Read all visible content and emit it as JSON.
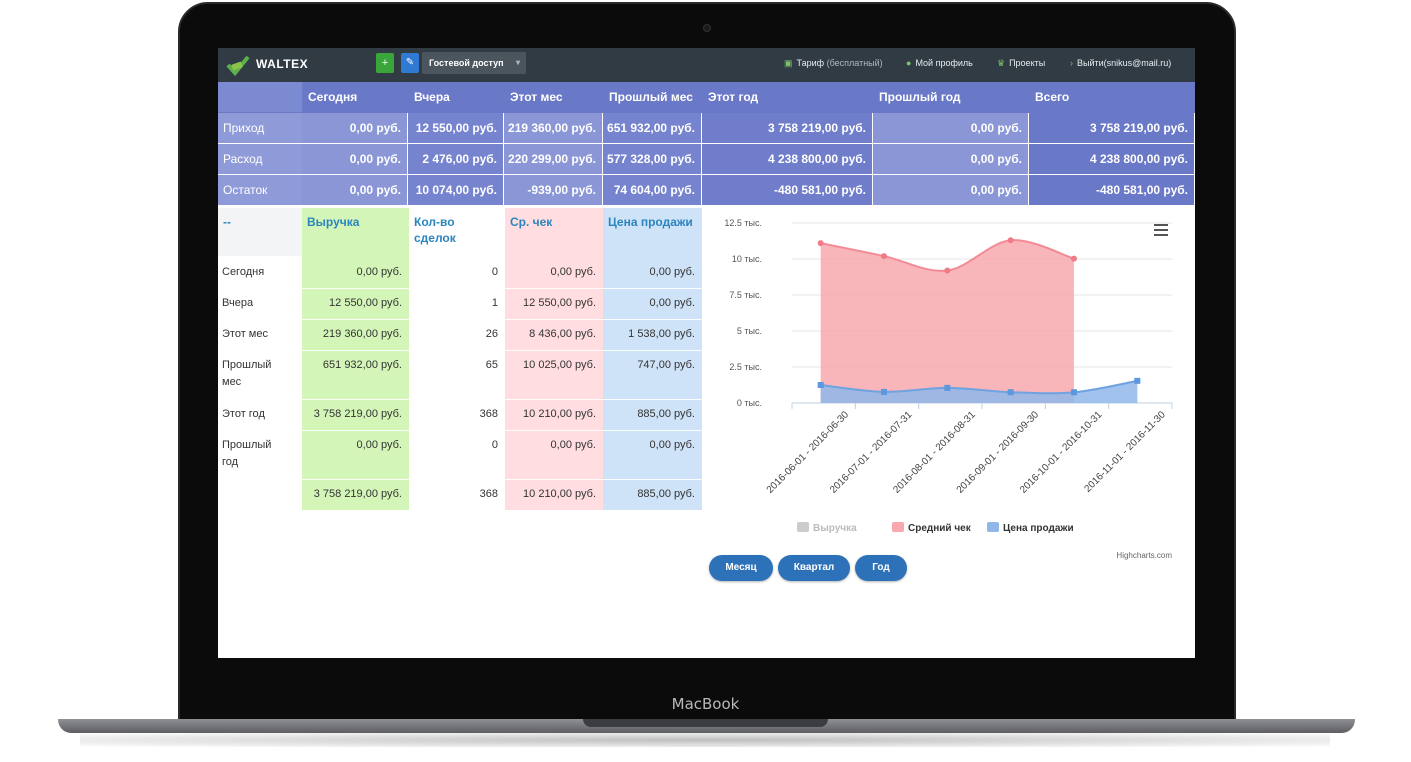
{
  "device": {
    "brand": "MacBook"
  },
  "nav": {
    "logo_text": "WALTEX",
    "add_label": "+",
    "guest_label": "Гостевой доступ",
    "tariff_label": "Тариф",
    "tariff_note": "(бесплатный)",
    "profile_label": "Мой профиль",
    "projects_label": "Проекты",
    "logout_label": "Выйти(snikus@mail.ru)"
  },
  "summary": {
    "headers": [
      "Сегодня",
      "Вчера",
      "Этот мес",
      "Прошлый мес",
      "Этот год",
      "Прошлый год",
      "Всего"
    ],
    "rows": [
      {
        "label": "Приход",
        "values": [
          "0,00 руб.",
          "12 550,00 руб.",
          "219 360,00 руб.",
          "651 932,00 руб.",
          "3 758 219,00 руб.",
          "0,00 руб.",
          "3 758 219,00 руб."
        ]
      },
      {
        "label": "Расход",
        "values": [
          "0,00 руб.",
          "2 476,00 руб.",
          "220 299,00 руб.",
          "577 328,00 руб.",
          "4 238 800,00 руб.",
          "0,00 руб.",
          "4 238 800,00 руб."
        ]
      },
      {
        "label": "Остаток",
        "values": [
          "0,00 руб.",
          "10 074,00 руб.",
          "-939,00 руб.",
          "74 604,00 руб.",
          "-480 581,00 руб.",
          "0,00 руб.",
          "-480 581,00 руб."
        ]
      }
    ]
  },
  "detail": {
    "headers": [
      "--",
      "Выручка",
      "Кол-во сделок",
      "Ср. чек",
      "Цена продажи"
    ],
    "rows": [
      {
        "label": "Сегодня",
        "revenue": "0,00 руб.",
        "deals": "0",
        "avg": "0,00 руб.",
        "price": "0,00 руб."
      },
      {
        "label": "Вчера",
        "revenue": "12 550,00 руб.",
        "deals": "1",
        "avg": "12 550,00 руб.",
        "price": "0,00 руб."
      },
      {
        "label": "Этот мес",
        "revenue": "219 360,00 руб.",
        "deals": "26",
        "avg": "8 436,00 руб.",
        "price": "1 538,00 руб."
      },
      {
        "label": "Прошлый мес",
        "revenue": "651 932,00 руб.",
        "deals": "65",
        "avg": "10 025,00 руб.",
        "price": "747,00 руб."
      },
      {
        "label": "Этот год",
        "revenue": "3 758 219,00 руб.",
        "deals": "368",
        "avg": "10 210,00 руб.",
        "price": "885,00 руб."
      },
      {
        "label": "Прошлый год",
        "revenue": "0,00 руб.",
        "deals": "0",
        "avg": "0,00 руб.",
        "price": "0,00 руб."
      },
      {
        "label": "",
        "revenue": "3 758 219,00 руб.",
        "deals": "368",
        "avg": "10 210,00 руб.",
        "price": "885,00 руб."
      }
    ]
  },
  "chart_data": {
    "type": "area",
    "x": [
      "2016-06-01 - 2016-06-30",
      "2016-07-01 - 2016-07-31",
      "2016-08-01 - 2016-08-31",
      "2016-09-01 - 2016-09-30",
      "2016-10-01 - 2016-10-31",
      "2016-11-01 - 2016-11-30"
    ],
    "y_ticks": [
      "0 тыс.",
      "2.5 тыс.",
      "5 тыс.",
      "7.5 тыс.",
      "10 тыс.",
      "12.5 тыс."
    ],
    "ylim": [
      0,
      12500
    ],
    "series": [
      {
        "name": "Выручка",
        "color": "#cccccc",
        "visible": false,
        "values": []
      },
      {
        "name": "Средний чек",
        "color": "#f7a8ae",
        "values": [
          11100,
          10200,
          9200,
          11300,
          10025,
          null
        ]
      },
      {
        "name": "Цена продажи",
        "color": "#8fb7ea",
        "values": [
          1250,
          770,
          1050,
          750,
          747,
          1538
        ]
      }
    ],
    "legend_position": "bottom",
    "credit": "Highcharts.com"
  },
  "periods": [
    "Месяц",
    "Квартал",
    "Год"
  ]
}
